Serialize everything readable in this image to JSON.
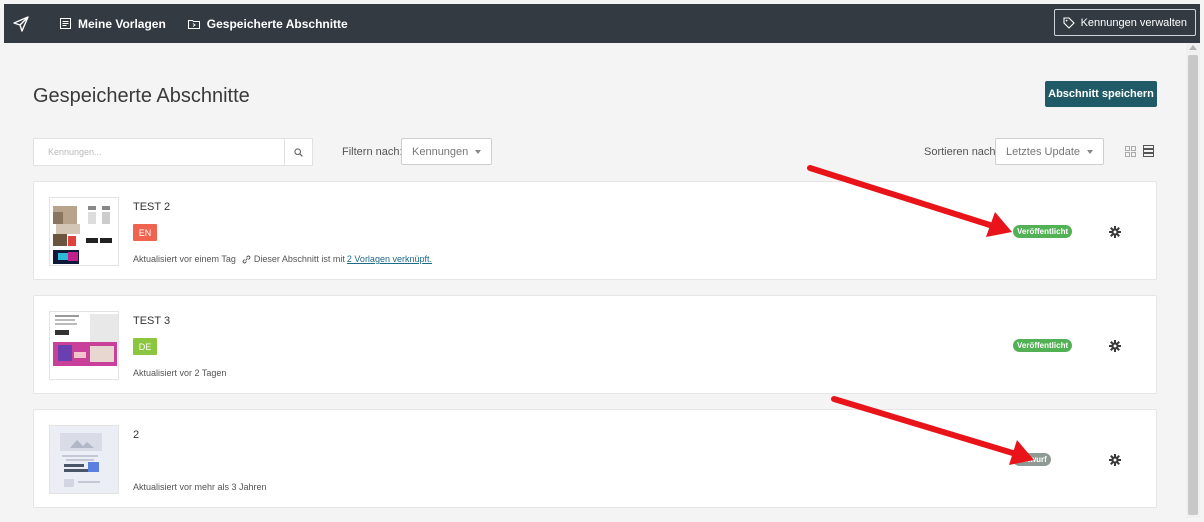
{
  "header": {
    "nav": [
      {
        "label": "Meine Vorlagen"
      },
      {
        "label": "Gespeicherte Abschnitte"
      }
    ],
    "manage_button": "Kennungen verwalten"
  },
  "page": {
    "title": "Gespeicherte Abschnitte",
    "save_button": "Abschnitt speichern"
  },
  "toolbar": {
    "search_placeholder": "Kennungen...",
    "filter_label": "Filtern nach:",
    "filter_value": "Kennungen",
    "sort_label": "Sortieren nach:",
    "sort_value": "Letztes Update"
  },
  "sections": [
    {
      "title": "TEST 2",
      "language": "EN",
      "language_color": "#f0644f",
      "updated": "Aktualisiert vor einem Tag",
      "linked_text": "Dieser Abschnitt ist mit",
      "linked_link": "2 Vorlagen verknüpft.",
      "status": "Veröffentlicht",
      "status_color": "#52b154"
    },
    {
      "title": "TEST 3",
      "language": "DE",
      "language_color": "#8cc63f",
      "updated": "Aktualisiert vor 2 Tagen",
      "status": "Veröffentlicht",
      "status_color": "#52b154"
    },
    {
      "title": "2",
      "updated": "Aktualisiert vor mehr als 3 Jahren",
      "status": "Entwurf",
      "status_color": "#8e9a93"
    }
  ],
  "colors": {
    "topbar": "#333a42",
    "primary": "#1f5a66",
    "annotation_arrow": "#e8141a"
  }
}
